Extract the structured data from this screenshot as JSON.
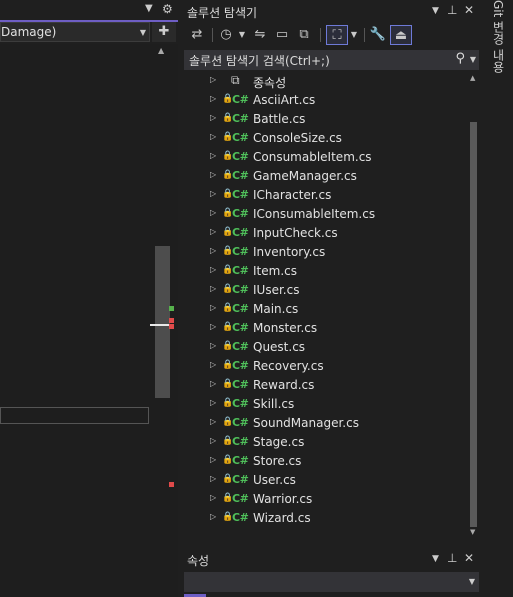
{
  "left_panel": {
    "combo_text": "Damage)",
    "split_icon": "split-vertical-icon"
  },
  "solution_explorer": {
    "title": "솔루션 탐색기",
    "search_placeholder": "솔루션 탐색기 검색(Ctrl+;)",
    "items": [
      {
        "type": "dependency",
        "label": "종속성"
      },
      {
        "type": "cs",
        "label": "AsciiArt.cs"
      },
      {
        "type": "cs",
        "label": "Battle.cs"
      },
      {
        "type": "cs",
        "label": "ConsoleSize.cs"
      },
      {
        "type": "cs",
        "label": "ConsumableItem.cs"
      },
      {
        "type": "cs",
        "label": "GameManager.cs"
      },
      {
        "type": "cs",
        "label": "ICharacter.cs"
      },
      {
        "type": "cs",
        "label": "IConsumableItem.cs"
      },
      {
        "type": "cs",
        "label": "InputCheck.cs"
      },
      {
        "type": "cs",
        "label": "Inventory.cs"
      },
      {
        "type": "cs",
        "label": "Item.cs"
      },
      {
        "type": "cs",
        "label": "IUser.cs"
      },
      {
        "type": "cs",
        "label": "Main.cs"
      },
      {
        "type": "cs",
        "label": "Monster.cs"
      },
      {
        "type": "cs",
        "label": "Quest.cs"
      },
      {
        "type": "cs",
        "label": "Recovery.cs"
      },
      {
        "type": "cs",
        "label": "Reward.cs"
      },
      {
        "type": "cs",
        "label": "Skill.cs"
      },
      {
        "type": "cs",
        "label": "SoundManager.cs"
      },
      {
        "type": "cs",
        "label": "Stage.cs"
      },
      {
        "type": "cs",
        "label": "Store.cs"
      },
      {
        "type": "cs",
        "label": "User.cs"
      },
      {
        "type": "cs",
        "label": "Warrior.cs"
      },
      {
        "type": "cs",
        "label": "Wizard.cs"
      }
    ],
    "cs_badge": "C#"
  },
  "properties": {
    "title": "속성"
  },
  "side_tab": {
    "label": "Git 변경 내용"
  },
  "colors": {
    "accent": "#6e5ec4",
    "csharp": "#4fbf5a",
    "background": "#1f1f1f"
  }
}
